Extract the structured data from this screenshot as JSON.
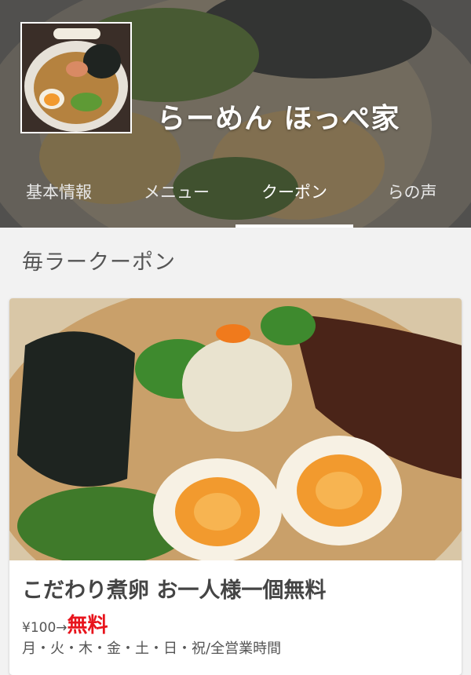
{
  "shop": {
    "name": "らーめん ほっぺ家"
  },
  "tabs": [
    {
      "label": "基本情報"
    },
    {
      "label": "メニュー"
    },
    {
      "label": "クーポン"
    },
    {
      "label": "らの声"
    }
  ],
  "active_tab": "クーポン",
  "section": {
    "title": "毎ラークーポン"
  },
  "coupon": {
    "title": "こだわり煮卵 お一人様一個無料",
    "price_old": "¥100→",
    "price_new": "無料",
    "valid": "月・火・木・金・土・日・祝/全営業時間"
  },
  "colors": {
    "accent_red": "#e8141c",
    "tab_indicator": "#ffffff",
    "background": "#f2f2f2"
  }
}
